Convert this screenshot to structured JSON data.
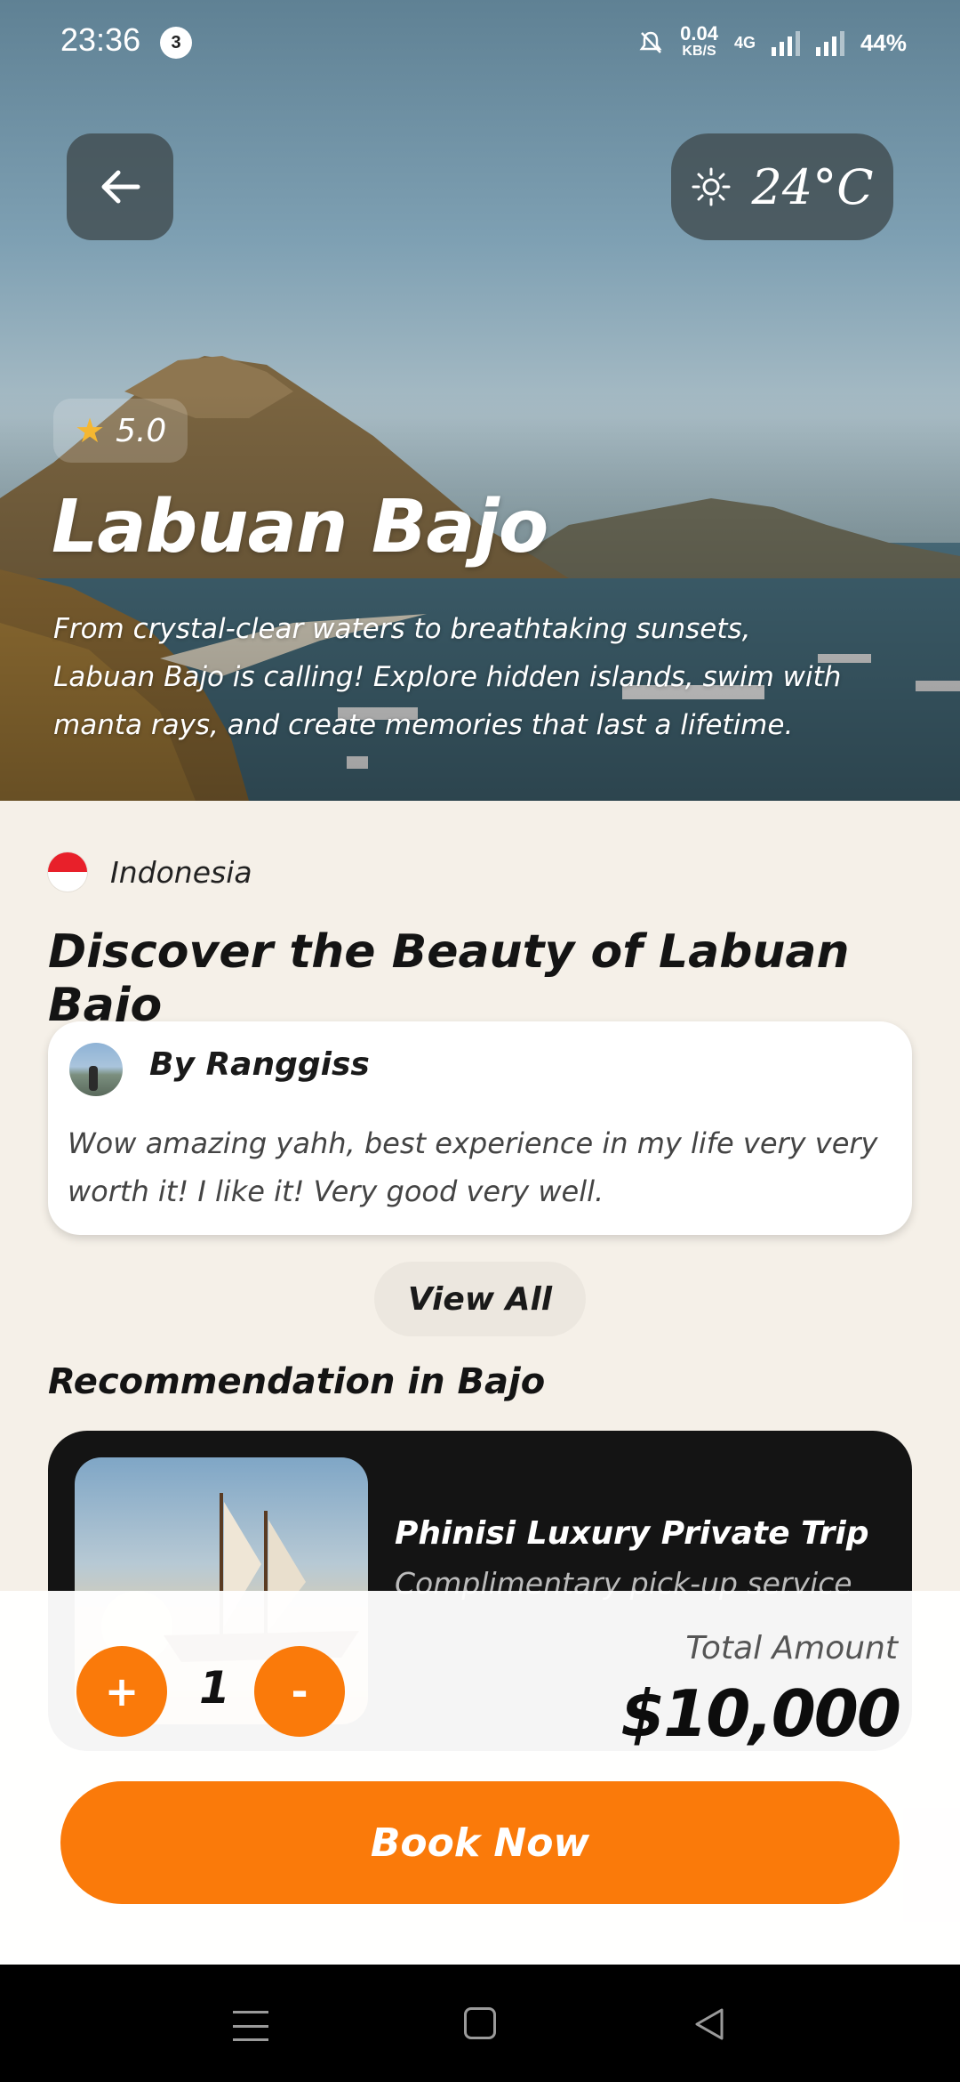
{
  "status_bar": {
    "time": "23:36",
    "notification_count": "3",
    "speed_value": "0.04",
    "speed_unit": "KB/S",
    "network": "4G",
    "battery": "44%"
  },
  "hero": {
    "temperature": "24°C",
    "rating": "5.0",
    "title": "Labuan Bajo",
    "description": "From crystal-clear waters to breathtaking sunsets, Labuan Bajo is calling! Explore hidden islands, swim with manta rays, and create memories that last a lifetime."
  },
  "country": "Indonesia",
  "section_title": "Discover the Beauty of Labuan Bajo",
  "review": {
    "author": "By Ranggiss",
    "text": "Wow amazing yahh, best experience in my life very very worth it! I like it! Very good very well."
  },
  "view_all_label": "View All",
  "recommendation": {
    "title": "Recommendation in Bajo",
    "items": [
      {
        "name": "Phinisi Luxury Private Trip",
        "subtitle": "Complimentary pick-up service"
      }
    ]
  },
  "booking": {
    "plus_label": "+",
    "minus_label": "-",
    "quantity": "1",
    "total_label": "Total Amount",
    "total_amount": "$10,000",
    "book_label": "Book Now"
  },
  "colors": {
    "accent": "#fa7a0a",
    "background": "#f5f0e8",
    "card_dark": "#141414",
    "star": "#f5b731"
  },
  "icons": [
    "back-arrow-icon",
    "sun-icon",
    "star-icon",
    "menu-icon",
    "home-icon",
    "nav-back-icon",
    "mute-icon"
  ]
}
